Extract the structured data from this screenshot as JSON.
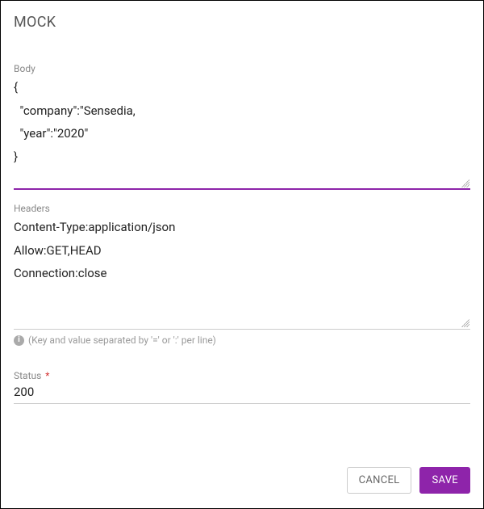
{
  "title": "MOCK",
  "body": {
    "label": "Body",
    "value": "{\n  \"company\":\"Sensedia,\n  \"year\":\"2020\"\n}"
  },
  "headers": {
    "label": "Headers",
    "value": "Content-Type:application/json\nAllow:GET,HEAD\nConnection:close",
    "hint": "(Key and value separated by '=' or ':' per line)"
  },
  "status": {
    "label": "Status",
    "required_marker": "*",
    "value": "200"
  },
  "actions": {
    "cancel": "CANCEL",
    "save": "SAVE"
  }
}
